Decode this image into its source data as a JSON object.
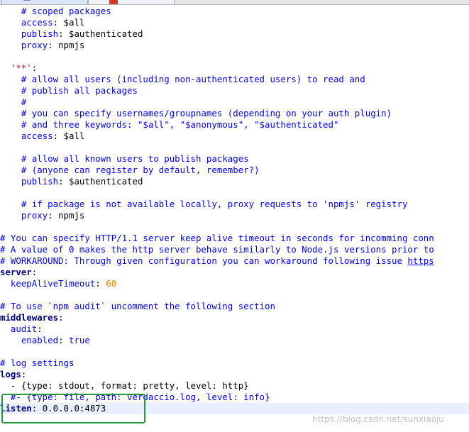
{
  "lines": [
    {
      "t": "comment",
      "indent": "    ",
      "text": "# scoped packages"
    },
    {
      "t": "kv",
      "indent": "    ",
      "key": "access",
      "value": "$all"
    },
    {
      "t": "kv",
      "indent": "    ",
      "key": "publish",
      "value": "$authenticated"
    },
    {
      "t": "kv",
      "indent": "    ",
      "key": "proxy",
      "value": "npmjs"
    },
    {
      "t": "blank"
    },
    {
      "t": "quoted_key",
      "indent": "  ",
      "key": "'**'",
      "suffix": ":"
    },
    {
      "t": "comment",
      "indent": "    ",
      "text": "# allow all users (including non-authenticated users) to read and"
    },
    {
      "t": "comment",
      "indent": "    ",
      "text": "# publish all packages"
    },
    {
      "t": "comment",
      "indent": "    ",
      "text": "#"
    },
    {
      "t": "comment",
      "indent": "    ",
      "text": "# you can specify usernames/groupnames (depending on your auth plugin)"
    },
    {
      "t": "comment",
      "indent": "    ",
      "text": "# and three keywords: \"$all\", \"$anonymous\", \"$authenticated\""
    },
    {
      "t": "kv",
      "indent": "    ",
      "key": "access",
      "value": "$all"
    },
    {
      "t": "blank"
    },
    {
      "t": "comment",
      "indent": "    ",
      "text": "# allow all known users to publish packages"
    },
    {
      "t": "comment",
      "indent": "    ",
      "text": "# (anyone can register by default, remember?)"
    },
    {
      "t": "kv",
      "indent": "    ",
      "key": "publish",
      "value": "$authenticated"
    },
    {
      "t": "blank"
    },
    {
      "t": "comment",
      "indent": "    ",
      "text": "# if package is not available locally, proxy requests to 'npmjs' registry"
    },
    {
      "t": "kv",
      "indent": "    ",
      "key": "proxy",
      "value": "npmjs"
    },
    {
      "t": "blank"
    },
    {
      "t": "comment",
      "indent": "",
      "text": "# You can specify HTTP/1.1 server keep alive timeout in seconds for incomming conn"
    },
    {
      "t": "comment",
      "indent": "",
      "text": "# A value of 0 makes the http server behave similarly to Node.js versions prior to"
    },
    {
      "t": "comment_link",
      "indent": "",
      "text": "# WORKAROUND: Through given configuration you can workaround following issue ",
      "link": "https"
    },
    {
      "t": "topkey",
      "indent": "",
      "key": "server"
    },
    {
      "t": "kv_num",
      "indent": "  ",
      "key": "keepAliveTimeout",
      "value": "60"
    },
    {
      "t": "blank"
    },
    {
      "t": "comment",
      "indent": "",
      "text": "# To use `npm audit` uncomment the following section"
    },
    {
      "t": "topkey",
      "indent": "",
      "key": "middlewares"
    },
    {
      "t": "subkey",
      "indent": "  ",
      "key": "audit"
    },
    {
      "t": "kv_bool",
      "indent": "    ",
      "key": "enabled",
      "value": "true"
    },
    {
      "t": "blank"
    },
    {
      "t": "comment",
      "indent": "",
      "text": "# log settings"
    },
    {
      "t": "topkey",
      "indent": "",
      "key": "logs"
    },
    {
      "t": "flow",
      "indent": "  ",
      "text": "- {type: stdout, format: pretty, level: http}"
    },
    {
      "t": "comment",
      "indent": "  ",
      "text": "#- {type: file, path: verdaccio.log, level: info}"
    },
    {
      "t": "kv_plain",
      "indent": "",
      "key": "listen",
      "value": "0.0.0.0:4873",
      "current": true
    }
  ],
  "watermark": "https://blog.csdn.net/sunxiaoju",
  "colors": {
    "comment": "#0000ff",
    "number": "#ff8000",
    "highlight": "#1e9b3c"
  }
}
